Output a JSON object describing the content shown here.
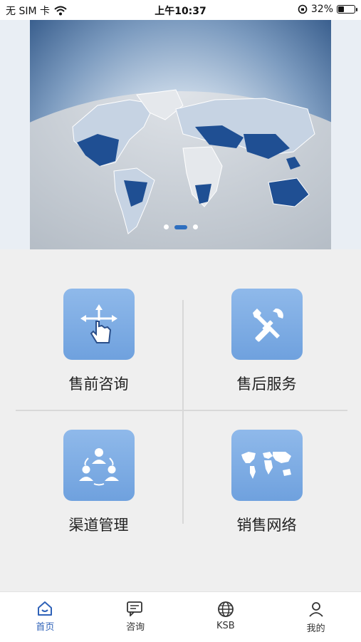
{
  "status_bar": {
    "carrier": "无 SIM 卡",
    "time": "上午10:37",
    "battery": "32%",
    "battery_level": 0.32
  },
  "banner": {
    "slides": 3,
    "active_slide": 2
  },
  "menu": [
    {
      "label": "售前咨询",
      "icon": "touch-move-icon"
    },
    {
      "label": "售后服务",
      "icon": "wrench-screwdriver-icon"
    },
    {
      "label": "渠道管理",
      "icon": "people-network-icon"
    },
    {
      "label": "销售网络",
      "icon": "world-map-icon"
    }
  ],
  "tabs": [
    {
      "label": "首页",
      "icon": "home-icon",
      "active": true
    },
    {
      "label": "咨询",
      "icon": "chat-icon",
      "active": false
    },
    {
      "label": "KSB",
      "icon": "globe-icon",
      "active": false
    },
    {
      "label": "我的",
      "icon": "user-icon",
      "active": false
    }
  ],
  "colors": {
    "accent": "#2f62b8",
    "tile": "#7aabe3",
    "map_highlight": "#1f4f93"
  }
}
